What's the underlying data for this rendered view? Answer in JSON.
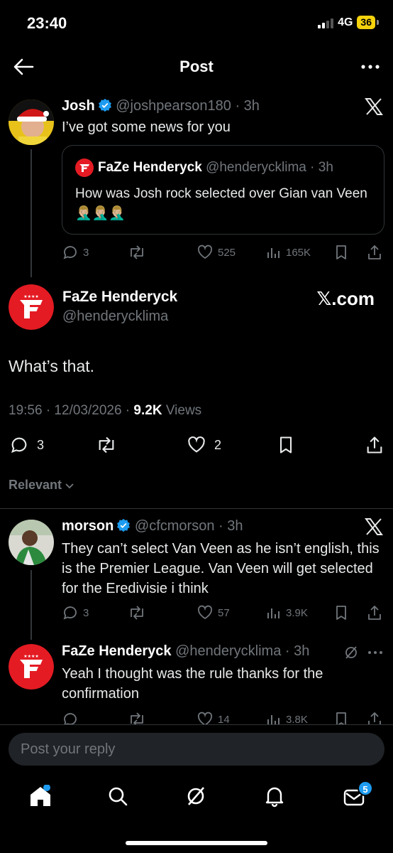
{
  "status": {
    "time": "23:40",
    "network": "4G",
    "battery": "36"
  },
  "header": {
    "title": "Post"
  },
  "parent_post": {
    "name": "Josh",
    "handle": "@joshpearson180",
    "time": "· 3h",
    "text": "I’ve got some news for you",
    "quote": {
      "name": "FaZe Henderyck",
      "handle": "@henderycklima",
      "time": "· 3h",
      "text": "How was Josh rock selected over Gian van Veen 🤦🏼‍♂️🤦🏼‍♂️🤦🏼‍♂️"
    },
    "replies": "3",
    "likes": "525",
    "views": "165K"
  },
  "main_post": {
    "name": "FaZe Henderyck",
    "handle": "@henderycklima",
    "source": "𝕏.com",
    "text": "What’s that.",
    "timestamp": "19:56 · 12/03/2026 · ",
    "views_count": "9.2K",
    "views_label": " Views",
    "replies": "3",
    "likes": "2"
  },
  "sort": {
    "label": "Relevant"
  },
  "replies": [
    {
      "name": "morson",
      "handle": "@cfcmorson",
      "time": "· 3h",
      "text": "They can’t select Van Veen as he isn’t english, this is the Premier League. Van Veen will get selected for the Eredivisie i think",
      "replies": "3",
      "likes": "57",
      "views": "3.9K"
    },
    {
      "name": "FaZe Henderyck",
      "handle": "@henderycklima",
      "time": "· 3h",
      "text": "Yeah I thought was the rule thanks for the confirmation",
      "likes": "14",
      "views": "3.8K"
    }
  ],
  "reply_input": {
    "placeholder": "Post your reply"
  },
  "tabbar": {
    "messages_badge": "5"
  },
  "colors": {
    "accent": "#1d9bf0",
    "faze_red": "#e41b23",
    "background": "#000000"
  }
}
